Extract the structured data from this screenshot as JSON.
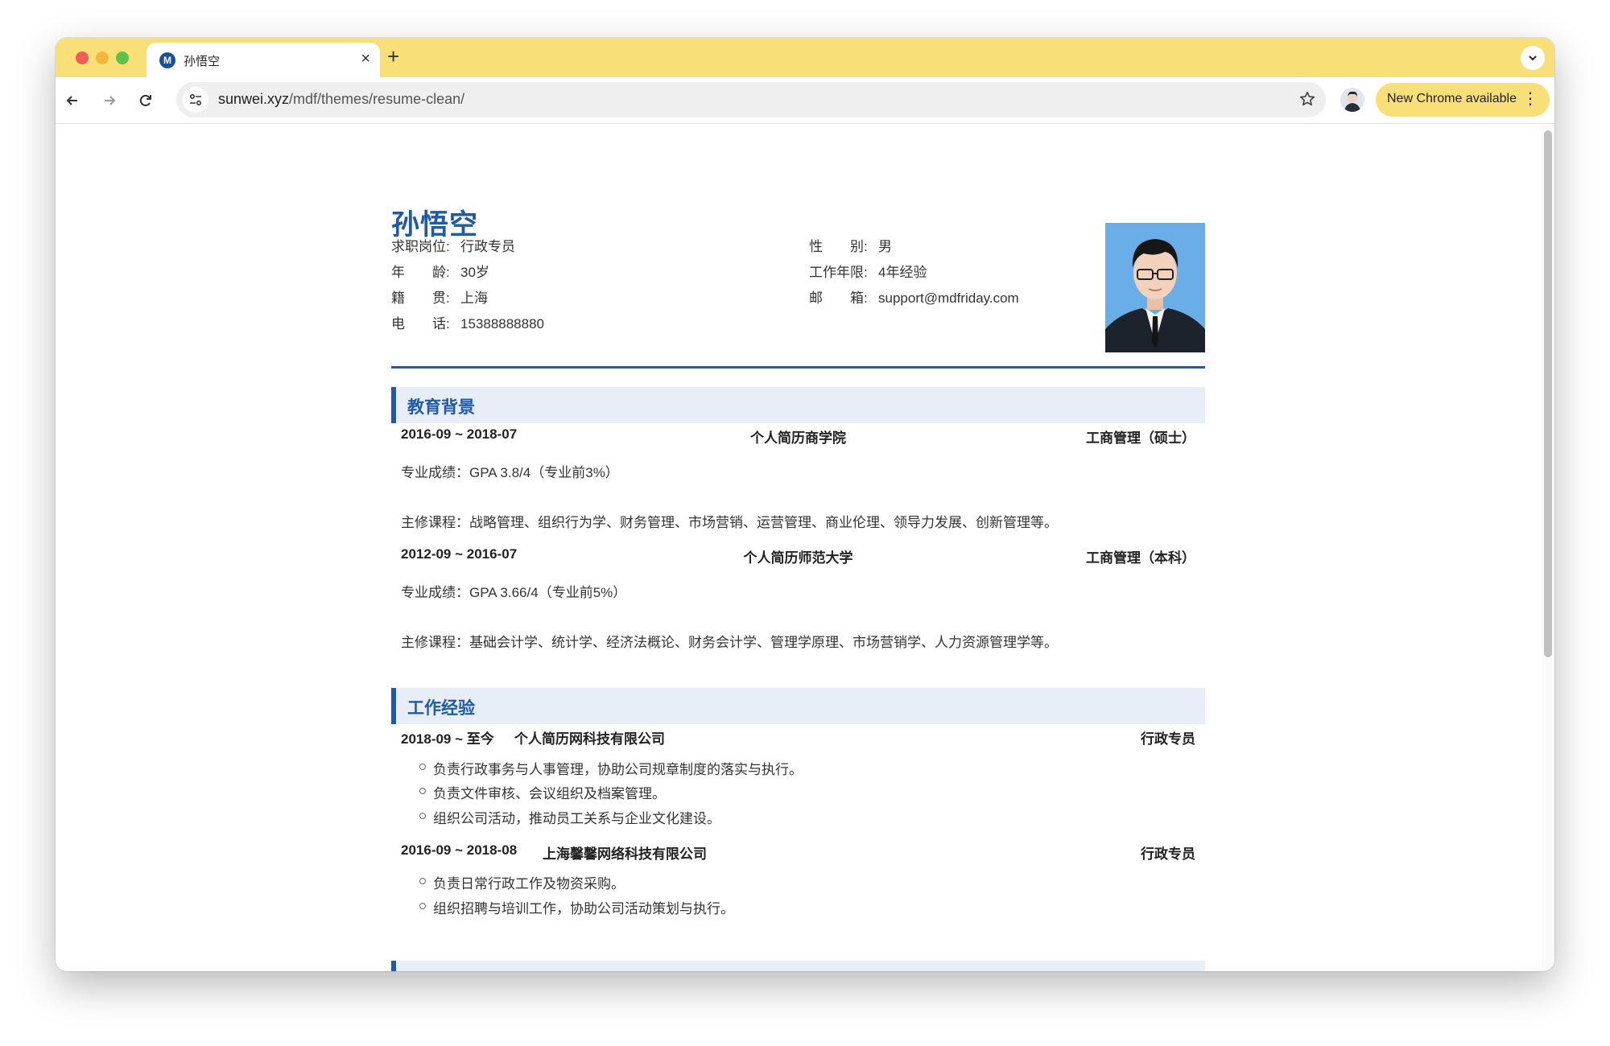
{
  "browser": {
    "tab_title": "孙悟空",
    "tab_favicon_letter": "M",
    "url_domain": "sunwei.xyz",
    "url_path": "/mdf/themes/resume-clean/",
    "update_label": "New Chrome available",
    "accent_color": "#f9df78"
  },
  "resume": {
    "name": "孙悟空",
    "info_left": [
      {
        "label": "求职岗位:",
        "value": "行政专员"
      },
      {
        "label": "年　　龄:",
        "value": "30岁"
      },
      {
        "label": "籍　　贯:",
        "value": "上海"
      },
      {
        "label": "电　　话:",
        "value": "15388888880"
      }
    ],
    "info_right": [
      {
        "label": "性　　别:",
        "value": "男"
      },
      {
        "label": "工作年限:",
        "value": "4年经验"
      },
      {
        "label": "邮　　箱:",
        "value": "support@mdfriday.com"
      }
    ],
    "theme_color": "#1f5aa6",
    "education": {
      "title": "教育背景",
      "entries": [
        {
          "date": "2016-09 ~ 2018-07",
          "school": "个人简历商学院",
          "degree": "工商管理（硕士）",
          "gpa": "专业成绩：GPA 3.8/4（专业前3%）",
          "courses": "主修课程：战略管理、组织行为学、财务管理、市场营销、运营管理、商业伦理、领导力发展、创新管理等。"
        },
        {
          "date": "2012-09 ~ 2016-07",
          "school": "个人简历师范大学",
          "degree": "工商管理（本科）",
          "gpa": "专业成绩：GPA 3.66/4（专业前5%）",
          "courses": "主修课程：基础会计学、统计学、经济法概论、财务会计学、管理学原理、市场营销学、人力资源管理学等。"
        }
      ]
    },
    "work": {
      "title": "工作经验",
      "entries": [
        {
          "date": "2018-09 ~ 至今",
          "company": "个人简历网科技有限公司",
          "position": "行政专员",
          "duties": [
            "负责行政事务与人事管理，协助公司规章制度的落实与执行。",
            "负责文件审核、会议组织及档案管理。",
            "组织公司活动，推动员工关系与企业文化建设。"
          ]
        },
        {
          "date": "2016-09 ~ 2018-08",
          "company": "上海馨馨网络科技有限公司",
          "position": "行政专员",
          "duties": [
            "负责日常行政工作及物资采购。",
            "组织招聘与培训工作，协助公司活动策划与执行。"
          ]
        }
      ]
    }
  }
}
